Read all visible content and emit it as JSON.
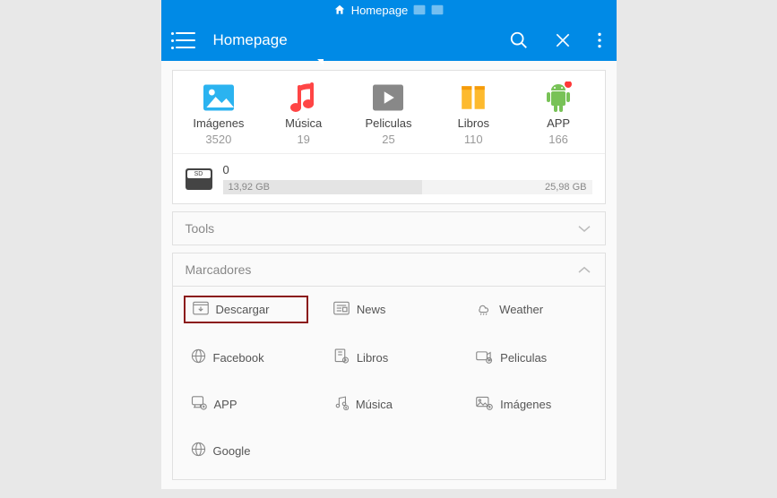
{
  "tabbar": {
    "label": "Homepage"
  },
  "toolbar": {
    "title": "Homepage"
  },
  "media": [
    {
      "label": "Imágenes",
      "count": "3520",
      "icon": "images"
    },
    {
      "label": "Música",
      "count": "19",
      "icon": "music"
    },
    {
      "label": "Peliculas",
      "count": "25",
      "icon": "video"
    },
    {
      "label": "Libros",
      "count": "110",
      "icon": "books"
    },
    {
      "label": "APP",
      "count": "166",
      "icon": "android"
    }
  ],
  "storage": {
    "index": "0",
    "used": "13,92 GB",
    "total": "25,98 GB",
    "percent": 54
  },
  "sections": {
    "tools": "Tools",
    "bookmarks": "Marcadores"
  },
  "bookmarks": [
    {
      "label": "Descargar",
      "icon": "download",
      "highlight": true
    },
    {
      "label": "News",
      "icon": "news"
    },
    {
      "label": "Weather",
      "icon": "weather"
    },
    {
      "label": "Facebook",
      "icon": "globe"
    },
    {
      "label": "Libros",
      "icon": "book-dl"
    },
    {
      "label": "Peliculas",
      "icon": "video-dl"
    },
    {
      "label": "APP",
      "icon": "app-dl"
    },
    {
      "label": "Música",
      "icon": "music-dl"
    },
    {
      "label": "Imágenes",
      "icon": "image-dl"
    },
    {
      "label": "Google",
      "icon": "globe"
    }
  ]
}
